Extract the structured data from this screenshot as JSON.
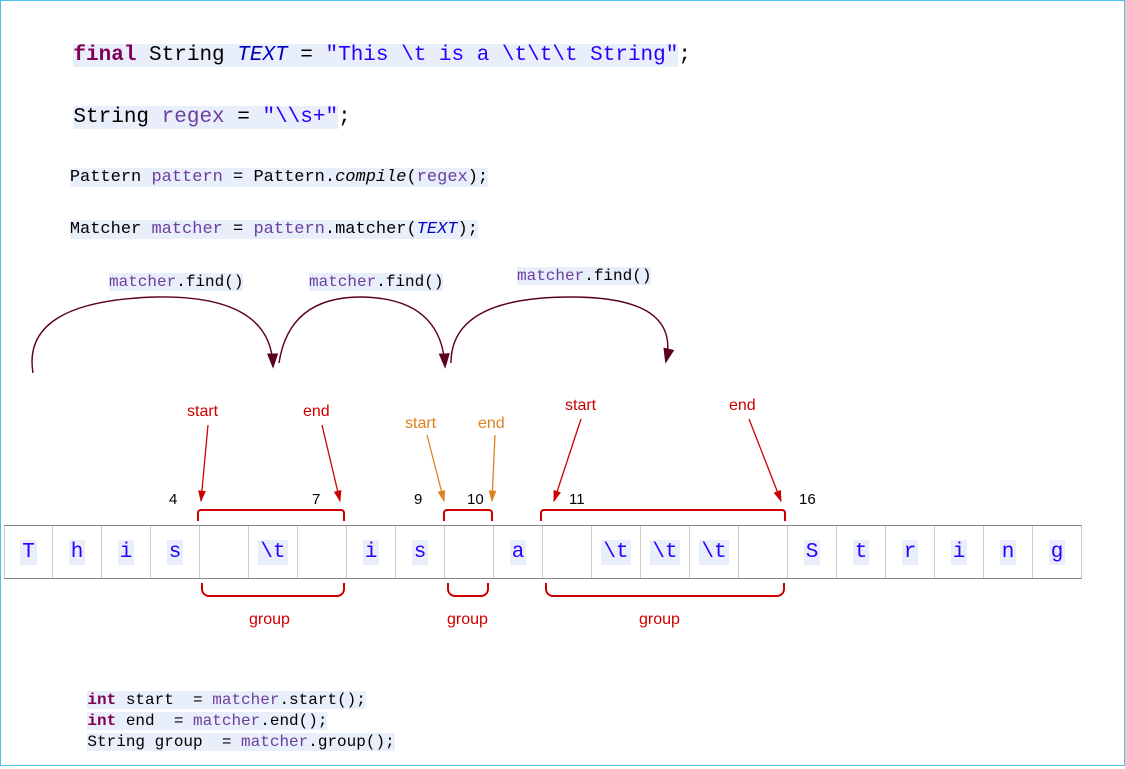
{
  "line1": {
    "final": "final",
    "string": " String ",
    "text": "TEXT",
    "eq": " = ",
    "lit": "\"This \\t is a \\t\\t\\t String\"",
    "semi": ";"
  },
  "line2": {
    "string": "String ",
    "regex": "regex",
    "eq": " = ",
    "lit": "\"\\\\s+\"",
    "semi": ";"
  },
  "line3": {
    "pattern_t": "Pattern ",
    "pattern_v": "pattern",
    "eq": " = ",
    "pattern_cls": "Pattern.",
    "compile": "compile",
    "open": "(",
    "arg": "regex",
    "close": ");"
  },
  "line4": {
    "matcher_t": "Matcher ",
    "matcher_v": "matcher",
    "eq": " = ",
    "pattern_v2": "pattern",
    "dot_matcher": ".matcher(",
    "text_arg": "TEXT",
    "close": ");"
  },
  "find": {
    "a": "matcher",
    "b": ".find()"
  },
  "labels": {
    "start": "start",
    "end": "end",
    "group": "group"
  },
  "indices": {
    "a1": "4",
    "a2": "7",
    "b1": "9",
    "b2": "10",
    "c1": "11",
    "c2": "16"
  },
  "cells": [
    "T",
    "h",
    "i",
    "s",
    " ",
    "\\t",
    " ",
    "i",
    "s",
    " ",
    "a",
    " ",
    "\\t",
    "\\t",
    "\\t",
    " ",
    "S",
    "t",
    "r",
    "i",
    "n",
    "g"
  ],
  "bottom": {
    "l1a": "int",
    "l1b": " start  = ",
    "l1c": "matcher",
    "l1d": ".start();",
    "l2a": "int",
    "l2b": " end  = ",
    "l2c": "matcher",
    "l2d": ".end();",
    "l3a": "String group  = ",
    "l3b": "matcher",
    "l3c": ".group();"
  }
}
